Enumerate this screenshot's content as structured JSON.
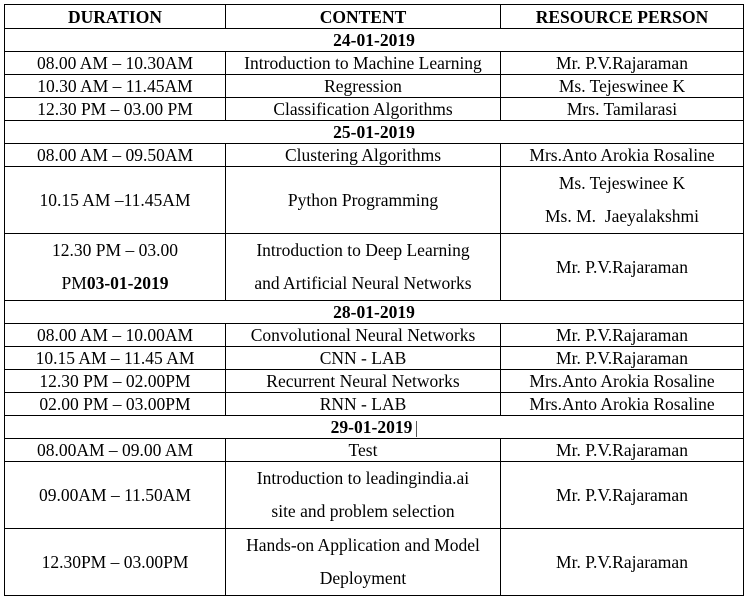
{
  "headers": {
    "duration": "DURATION",
    "content": "CONTENT",
    "resource": "RESOURCE PERSON"
  },
  "days": [
    {
      "date": "24-01-2019",
      "sessions": [
        {
          "duration": "08.00 AM – 10.30AM",
          "content": "Introduction to Machine Learning",
          "resource": "Mr. P.V.Rajaraman"
        },
        {
          "duration": "10.30 AM – 11.45AM",
          "content": "Regression",
          "resource": "Ms. Tejeswinee K"
        },
        {
          "duration": "12.30 PM – 03.00 PM",
          "content": "Classification Algorithms",
          "resource": "Mrs. Tamilarasi"
        }
      ]
    },
    {
      "date": "25-01-2019",
      "sessions": [
        {
          "duration": "08.00 AM – 09.50AM",
          "content": "Clustering Algorithms",
          "resource": "Mrs.Anto Arokia Rosaline"
        },
        {
          "duration": "10.15 AM –11.45AM",
          "content": "Python Programming",
          "resource_lines": [
            "Ms. Tejeswinee K",
            "Ms. M.  Jaeyalakshmi"
          ]
        },
        {
          "duration_lines": [
            "12.30 PM – 03.00",
            "PM"
          ],
          "duration_bold_suffix": "03-01-2019",
          "content_lines": [
            "Introduction to Deep Learning",
            "and Artificial Neural Networks"
          ],
          "resource": "Mr. P.V.Rajaraman"
        }
      ]
    },
    {
      "date": "28-01-2019",
      "sessions": [
        {
          "duration": "08.00 AM – 10.00AM",
          "content": "Convolutional Neural Networks",
          "resource": "Mr. P.V.Rajaraman"
        },
        {
          "duration": "10.15 AM – 11.45 AM",
          "content": "CNN - LAB",
          "resource": "Mr. P.V.Rajaraman"
        },
        {
          "duration": "12.30 PM – 02.00PM",
          "content": "Recurrent Neural Networks",
          "resource": "Mrs.Anto Arokia Rosaline"
        },
        {
          "duration": "02.00 PM – 03.00PM",
          "content": "RNN - LAB",
          "resource": "Mrs.Anto Arokia Rosaline"
        }
      ]
    },
    {
      "date": "29-01-2019",
      "sessions": [
        {
          "duration": "08.00AM – 09.00 AM",
          "content": "Test",
          "resource": "Mr. P.V.Rajaraman"
        },
        {
          "duration": "09.00AM – 11.50AM",
          "content_lines": [
            "Introduction to leadingindia.ai",
            "site and problem selection"
          ],
          "resource": "Mr. P.V.Rajaraman"
        },
        {
          "duration": "12.30PM – 03.00PM",
          "content_lines": [
            "Hands-on Application and Model",
            "Deployment"
          ],
          "resource": "Mr. P.V.Rajaraman"
        }
      ]
    }
  ]
}
